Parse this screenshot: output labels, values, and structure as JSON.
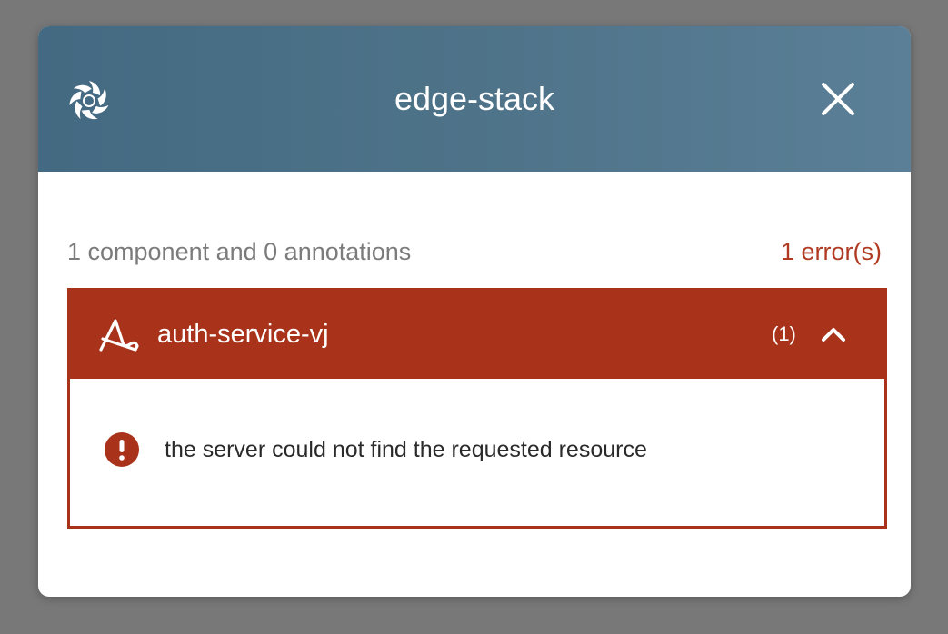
{
  "modal": {
    "title": "edge-stack",
    "logo_icon": "edge-stack-logo-icon",
    "close_icon": "close-icon",
    "header_gradient": [
      "#436a82",
      "#5a7f96"
    ]
  },
  "summary": {
    "text": "1 component and 0 annotations",
    "errors": "1 error(s)"
  },
  "components": [
    {
      "icon": "ambassador-service-icon",
      "name": "auth-service-vj",
      "count": "(1)",
      "expanded": true,
      "chevron_icon": "chevron-up-icon",
      "errors": [
        {
          "icon": "error-alert-icon",
          "message": "the server could not find the requested resource"
        }
      ]
    }
  ],
  "colors": {
    "error_red": "#a9321b",
    "error_text": "#b03a22",
    "backdrop": "#787878"
  }
}
